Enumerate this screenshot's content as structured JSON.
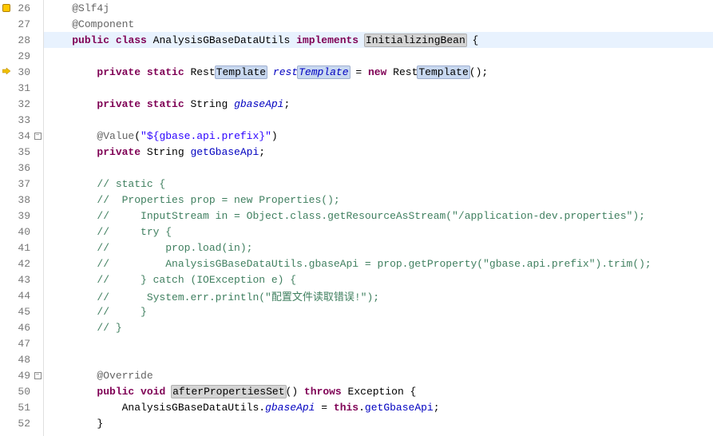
{
  "lines": [
    {
      "num": "26",
      "marker": "warn",
      "fold": "",
      "indent": "    ",
      "tokens": [
        {
          "cls": "tok-annotation",
          "txt": "@Slf4j"
        }
      ]
    },
    {
      "num": "27",
      "marker": "",
      "fold": "",
      "indent": "    ",
      "tokens": [
        {
          "cls": "tok-annotation",
          "txt": "@Component"
        }
      ]
    },
    {
      "num": "28",
      "marker": "",
      "fold": "",
      "indent": "    ",
      "hl": true,
      "tokens": [
        {
          "cls": "tok-keyword",
          "txt": "public"
        },
        {
          "cls": "",
          "txt": " "
        },
        {
          "cls": "tok-keyword",
          "txt": "class"
        },
        {
          "cls": "",
          "txt": " AnalysisGBaseDataUtils "
        },
        {
          "cls": "tok-keyword",
          "txt": "implements"
        },
        {
          "cls": "",
          "txt": " "
        },
        {
          "cls": "hl-box",
          "txt": "InitializingBean"
        },
        {
          "cls": "",
          "txt": " {"
        }
      ],
      "caretAfter": 9
    },
    {
      "num": "29",
      "marker": "",
      "fold": "",
      "indent": "    ",
      "tokens": []
    },
    {
      "num": "30",
      "marker": "arrow",
      "fold": "",
      "indent": "        ",
      "tokens": [
        {
          "cls": "tok-keyword",
          "txt": "private"
        },
        {
          "cls": "",
          "txt": " "
        },
        {
          "cls": "tok-keyword",
          "txt": "static"
        },
        {
          "cls": "",
          "txt": " Rest"
        },
        {
          "cls": "hl-box-blue",
          "txt": "Template"
        },
        {
          "cls": "",
          "txt": " "
        },
        {
          "cls": "tok-static-field",
          "txt": "rest"
        },
        {
          "cls": "tok-static-field hl-box-blue",
          "txt": "Template"
        },
        {
          "cls": "",
          "txt": " = "
        },
        {
          "cls": "tok-keyword",
          "txt": "new"
        },
        {
          "cls": "",
          "txt": " Rest"
        },
        {
          "cls": "hl-box-blue",
          "txt": "Template"
        },
        {
          "cls": "",
          "txt": "();"
        }
      ]
    },
    {
      "num": "31",
      "marker": "",
      "fold": "",
      "indent": "    ",
      "tokens": []
    },
    {
      "num": "32",
      "marker": "",
      "fold": "",
      "indent": "        ",
      "tokens": [
        {
          "cls": "tok-keyword",
          "txt": "private"
        },
        {
          "cls": "",
          "txt": " "
        },
        {
          "cls": "tok-keyword",
          "txt": "static"
        },
        {
          "cls": "",
          "txt": " String "
        },
        {
          "cls": "tok-static-field",
          "txt": "gbaseApi"
        },
        {
          "cls": "",
          "txt": ";"
        }
      ]
    },
    {
      "num": "33",
      "marker": "",
      "fold": "",
      "indent": "    ",
      "tokens": []
    },
    {
      "num": "34",
      "marker": "",
      "fold": "minus",
      "indent": "        ",
      "tokens": [
        {
          "cls": "tok-annotation",
          "txt": "@Value"
        },
        {
          "cls": "",
          "txt": "("
        },
        {
          "cls": "tok-string",
          "txt": "\"${gbase.api.prefix}\""
        },
        {
          "cls": "",
          "txt": ")"
        }
      ]
    },
    {
      "num": "35",
      "marker": "",
      "fold": "",
      "indent": "        ",
      "tokens": [
        {
          "cls": "tok-keyword",
          "txt": "private"
        },
        {
          "cls": "",
          "txt": " String "
        },
        {
          "cls": "tok-field",
          "txt": "getGbaseApi"
        },
        {
          "cls": "",
          "txt": ";"
        }
      ]
    },
    {
      "num": "36",
      "marker": "",
      "fold": "",
      "indent": "    ",
      "tokens": []
    },
    {
      "num": "37",
      "marker": "",
      "fold": "",
      "indent": "        ",
      "tokens": [
        {
          "cls": "tok-comment",
          "txt": "// static {"
        }
      ]
    },
    {
      "num": "38",
      "marker": "",
      "fold": "",
      "indent": "        ",
      "tokens": [
        {
          "cls": "tok-comment",
          "txt": "//  Properties prop = new Properties();"
        }
      ]
    },
    {
      "num": "39",
      "marker": "",
      "fold": "",
      "indent": "        ",
      "tokens": [
        {
          "cls": "tok-comment",
          "txt": "//     InputStream in = Object.class.getResourceAsStream(\"/application-dev.properties\");"
        }
      ]
    },
    {
      "num": "40",
      "marker": "",
      "fold": "",
      "indent": "        ",
      "tokens": [
        {
          "cls": "tok-comment",
          "txt": "//     try {"
        }
      ]
    },
    {
      "num": "41",
      "marker": "",
      "fold": "",
      "indent": "        ",
      "tokens": [
        {
          "cls": "tok-comment",
          "txt": "//         prop.load(in);"
        }
      ]
    },
    {
      "num": "42",
      "marker": "",
      "fold": "",
      "indent": "        ",
      "tokens": [
        {
          "cls": "tok-comment",
          "txt": "//         AnalysisGBaseDataUtils.gbaseApi = prop.getProperty(\"gbase.api.prefix\").trim();"
        }
      ]
    },
    {
      "num": "43",
      "marker": "",
      "fold": "",
      "indent": "        ",
      "tokens": [
        {
          "cls": "tok-comment",
          "txt": "//     } catch (IOException e) {"
        }
      ]
    },
    {
      "num": "44",
      "marker": "",
      "fold": "",
      "indent": "        ",
      "tokens": [
        {
          "cls": "tok-comment",
          "txt": "//      System.err.println(\"配置文件读取错误!\");"
        }
      ]
    },
    {
      "num": "45",
      "marker": "",
      "fold": "",
      "indent": "        ",
      "tokens": [
        {
          "cls": "tok-comment",
          "txt": "//     }"
        }
      ]
    },
    {
      "num": "46",
      "marker": "",
      "fold": "",
      "indent": "        ",
      "tokens": [
        {
          "cls": "tok-comment",
          "txt": "// }"
        }
      ]
    },
    {
      "num": "47",
      "marker": "",
      "fold": "",
      "indent": "    ",
      "tokens": []
    },
    {
      "num": "48",
      "marker": "",
      "fold": "",
      "indent": "    ",
      "tokens": []
    },
    {
      "num": "49",
      "marker": "",
      "fold": "minus",
      "indent": "        ",
      "tokens": [
        {
          "cls": "tok-annotation",
          "txt": "@Override"
        }
      ]
    },
    {
      "num": "50",
      "marker": "",
      "fold": "",
      "indent": "        ",
      "tokens": [
        {
          "cls": "tok-keyword",
          "txt": "public"
        },
        {
          "cls": "",
          "txt": " "
        },
        {
          "cls": "tok-keyword",
          "txt": "void"
        },
        {
          "cls": "",
          "txt": " "
        },
        {
          "cls": "hl-box",
          "txt": "afterPropertiesSet"
        },
        {
          "cls": "",
          "txt": "() "
        },
        {
          "cls": "tok-keyword",
          "txt": "throws"
        },
        {
          "cls": "",
          "txt": " Exception {"
        }
      ]
    },
    {
      "num": "51",
      "marker": "",
      "fold": "",
      "indent": "            ",
      "tokens": [
        {
          "cls": "",
          "txt": "AnalysisGBaseDataUtils."
        },
        {
          "cls": "tok-static-field",
          "txt": "gbaseApi"
        },
        {
          "cls": "",
          "txt": " = "
        },
        {
          "cls": "tok-keyword",
          "txt": "this"
        },
        {
          "cls": "",
          "txt": "."
        },
        {
          "cls": "tok-field",
          "txt": "getGbaseApi"
        },
        {
          "cls": "",
          "txt": ";"
        }
      ]
    },
    {
      "num": "52",
      "marker": "",
      "fold": "",
      "indent": "        ",
      "tokens": [
        {
          "cls": "",
          "txt": "}"
        }
      ]
    }
  ]
}
